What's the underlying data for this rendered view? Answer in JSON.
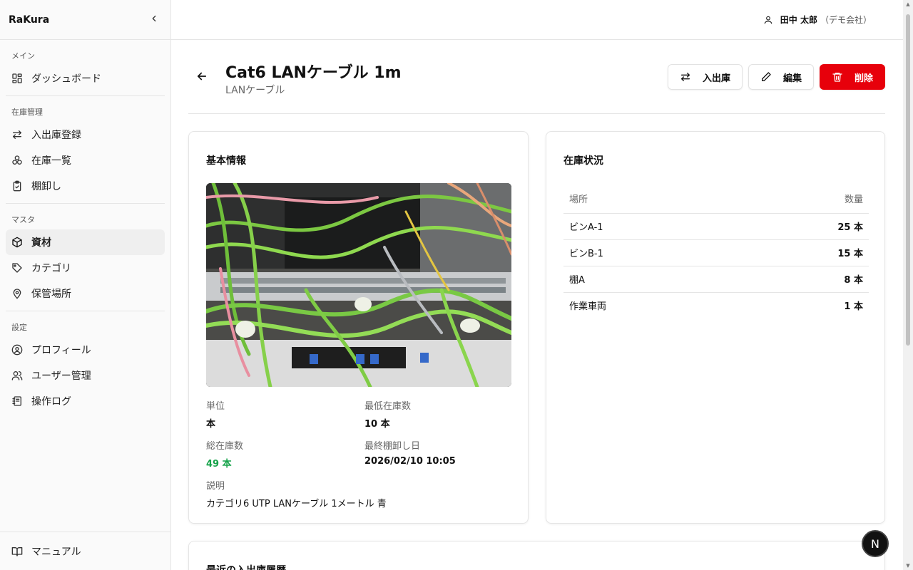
{
  "sidebar": {
    "brand": "RaKura",
    "groups": [
      {
        "label": "メイン",
        "items": [
          {
            "label": "ダッシュボード",
            "icon": "dashboard-icon"
          }
        ]
      },
      {
        "label": "在庫管理",
        "items": [
          {
            "label": "入出庫登録",
            "icon": "transfer-icon"
          },
          {
            "label": "在庫一覧",
            "icon": "boxes-icon"
          },
          {
            "label": "棚卸し",
            "icon": "clipboard-check-icon"
          }
        ]
      },
      {
        "label": "マスタ",
        "items": [
          {
            "label": "資材",
            "icon": "package-icon",
            "active": true
          },
          {
            "label": "カテゴリ",
            "icon": "tag-icon"
          },
          {
            "label": "保管場所",
            "icon": "map-pin-icon"
          }
        ]
      },
      {
        "label": "設定",
        "items": [
          {
            "label": "プロフィール",
            "icon": "user-circle-icon"
          },
          {
            "label": "ユーザー管理",
            "icon": "users-icon"
          },
          {
            "label": "操作ログ",
            "icon": "log-icon"
          }
        ]
      }
    ],
    "footer": {
      "label": "マニュアル",
      "icon": "book-icon"
    }
  },
  "header": {
    "user_name": "田中 太郎",
    "company": "（デモ会社）"
  },
  "page": {
    "title": "Cat6 LANケーブル 1m",
    "subtitle": "LANケーブル",
    "actions": {
      "inout": "入出庫",
      "edit": "編集",
      "delete": "削除"
    }
  },
  "basic": {
    "title": "基本情報",
    "unit_label": "単位",
    "unit_value": "本",
    "min_label": "最低在庫数",
    "min_value": "10 本",
    "total_label": "総在庫数",
    "total_value": "49 本",
    "last_label": "最終棚卸し日",
    "last_value": "2026/02/10 10:05",
    "desc_label": "説明",
    "desc_value": "カテゴリ6 UTP LANケーブル 1メートル 青"
  },
  "stock": {
    "title": "在庫状況",
    "col_location": "場所",
    "col_qty": "数量",
    "rows": [
      {
        "location": "ビンA-1",
        "qty": "25 本"
      },
      {
        "location": "ビンB-1",
        "qty": "15 本"
      },
      {
        "location": "棚A",
        "qty": "8 本"
      },
      {
        "location": "作業車両",
        "qty": "1 本"
      }
    ]
  },
  "history": {
    "title": "最近の入出庫履歴"
  },
  "fab_label": "N",
  "colors": {
    "accent_green": "#16a34a",
    "danger": "#e7000b"
  }
}
